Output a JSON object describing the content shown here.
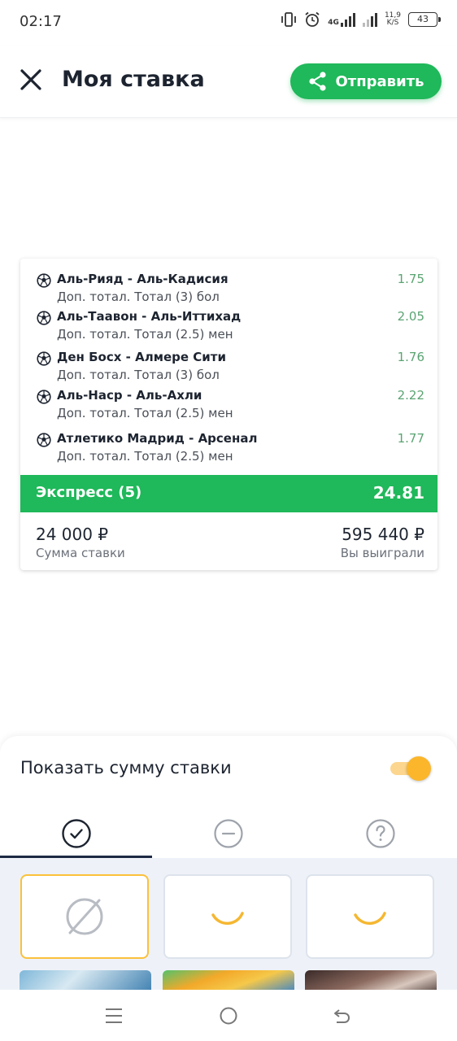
{
  "status_bar": {
    "time": "02:17",
    "network": "4G",
    "speed_value": "11,9",
    "speed_unit": "K/S",
    "battery": "43"
  },
  "header": {
    "title": "Моя ставка",
    "share_label": "Отправить",
    "icons": {
      "close": "close-icon",
      "share": "share-icon"
    }
  },
  "bet_card": {
    "events": [
      {
        "match": "Аль-Рияд - Аль-Кадисия",
        "market": "Доп. тотал. Тотал (3) бол",
        "odds": "1.75"
      },
      {
        "match": "Аль-Таавон - Аль-Иттихад",
        "market": "Доп. тотал. Тотал (2.5) мен",
        "odds": "2.05"
      },
      {
        "match": "Ден Босх - Алмере Сити",
        "market": "Доп. тотал. Тотал (3) бол",
        "odds": "1.76"
      },
      {
        "match": "Аль-Наср - Аль-Ахли",
        "market": "Доп. тотал. Тотал (2.5) мен",
        "odds": "2.22"
      },
      {
        "match": "Атлетико Мадрид - Арсенал",
        "market": "Доп. тотал. Тотал (2.5) мен",
        "odds": "1.77"
      }
    ],
    "express_label": "Экспресс (5)",
    "express_odds": "24.81",
    "stake_amount": "24 000 ₽",
    "stake_label": "Сумма ставки",
    "win_amount": "595 440 ₽",
    "win_label": "Вы выиграли"
  },
  "bottom_sheet": {
    "toggle_label": "Показать сумму ставки",
    "toggle_on": true,
    "tabs": [
      {
        "icon": "check-circle-icon",
        "active": true
      },
      {
        "icon": "minus-circle-icon",
        "active": false
      },
      {
        "icon": "question-circle-icon",
        "active": false
      }
    ],
    "tiles": [
      {
        "icon": "empty-set-icon",
        "selected": true
      },
      {
        "icon": "loading-spinner-icon",
        "selected": false
      },
      {
        "icon": "loading-spinner-icon",
        "selected": false
      }
    ]
  },
  "nav_bar": {
    "icons": [
      "menu-icon",
      "home-icon",
      "back-icon"
    ]
  },
  "colors": {
    "accent_green": "#1fb85a",
    "odds_green": "#5aa472",
    "toggle_yellow": "#fbb62b",
    "tile_selected_border": "#fbc13b",
    "tab_underline": "#1d2a44"
  }
}
